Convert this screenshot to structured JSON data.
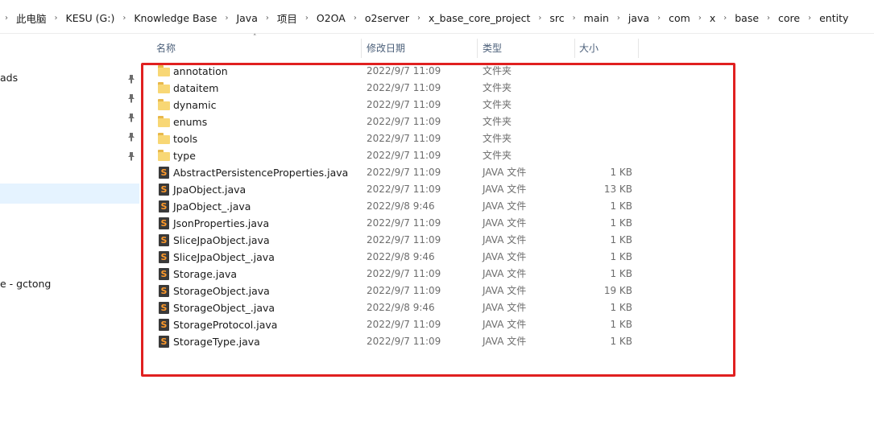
{
  "breadcrumb": [
    "此电脑",
    "KESU (G:)",
    "Knowledge Base",
    "Java",
    "项目",
    "O2OA",
    "o2server",
    "x_base_core_project",
    "src",
    "main",
    "java",
    "com",
    "x",
    "base",
    "core",
    "entity"
  ],
  "nav": {
    "items": [
      {
        "label": "ads",
        "pinned": true
      },
      {
        "label": "",
        "pinned": true
      },
      {
        "label": "",
        "pinned": true
      },
      {
        "label": "",
        "pinned": true
      },
      {
        "label": "",
        "pinned": true
      },
      {
        "label": "e - gctong",
        "pinned": false
      }
    ]
  },
  "columns": {
    "name": "名称",
    "date": "修改日期",
    "type": "类型",
    "size": "大小"
  },
  "files": [
    {
      "name": "annotation",
      "date": "2022/9/7 11:09",
      "type": "文件夹",
      "size": "",
      "icon": "folder-icon"
    },
    {
      "name": "dataitem",
      "date": "2022/9/7 11:09",
      "type": "文件夹",
      "size": "",
      "icon": "folder-icon"
    },
    {
      "name": "dynamic",
      "date": "2022/9/7 11:09",
      "type": "文件夹",
      "size": "",
      "icon": "folder-icon"
    },
    {
      "name": "enums",
      "date": "2022/9/7 11:09",
      "type": "文件夹",
      "size": "",
      "icon": "folder-icon"
    },
    {
      "name": "tools",
      "date": "2022/9/7 11:09",
      "type": "文件夹",
      "size": "",
      "icon": "folder-icon"
    },
    {
      "name": "type",
      "date": "2022/9/7 11:09",
      "type": "文件夹",
      "size": "",
      "icon": "folder-icon"
    },
    {
      "name": "AbstractPersistenceProperties.java",
      "date": "2022/9/7 11:09",
      "type": "JAVA 文件",
      "size": "1 KB",
      "icon": "java-file-icon"
    },
    {
      "name": "JpaObject.java",
      "date": "2022/9/7 11:09",
      "type": "JAVA 文件",
      "size": "13 KB",
      "icon": "java-file-icon"
    },
    {
      "name": "JpaObject_.java",
      "date": "2022/9/8 9:46",
      "type": "JAVA 文件",
      "size": "1 KB",
      "icon": "java-file-icon"
    },
    {
      "name": "JsonProperties.java",
      "date": "2022/9/7 11:09",
      "type": "JAVA 文件",
      "size": "1 KB",
      "icon": "java-file-icon"
    },
    {
      "name": "SliceJpaObject.java",
      "date": "2022/9/7 11:09",
      "type": "JAVA 文件",
      "size": "1 KB",
      "icon": "java-file-icon"
    },
    {
      "name": "SliceJpaObject_.java",
      "date": "2022/9/8 9:46",
      "type": "JAVA 文件",
      "size": "1 KB",
      "icon": "java-file-icon"
    },
    {
      "name": "Storage.java",
      "date": "2022/9/7 11:09",
      "type": "JAVA 文件",
      "size": "1 KB",
      "icon": "java-file-icon"
    },
    {
      "name": "StorageObject.java",
      "date": "2022/9/7 11:09",
      "type": "JAVA 文件",
      "size": "19 KB",
      "icon": "java-file-icon"
    },
    {
      "name": "StorageObject_.java",
      "date": "2022/9/8 9:46",
      "type": "JAVA 文件",
      "size": "1 KB",
      "icon": "java-file-icon"
    },
    {
      "name": "StorageProtocol.java",
      "date": "2022/9/7 11:09",
      "type": "JAVA 文件",
      "size": "1 KB",
      "icon": "java-file-icon"
    },
    {
      "name": "StorageType.java",
      "date": "2022/9/7 11:09",
      "type": "JAVA 文件",
      "size": "1 KB",
      "icon": "java-file-icon"
    }
  ],
  "colors": {
    "highlight": "#e02020",
    "folder": "#f8d775",
    "java_icon_bg": "#3a3a3a",
    "java_icon_fg": "#ff9a2b",
    "selection": "#e5f3ff"
  }
}
